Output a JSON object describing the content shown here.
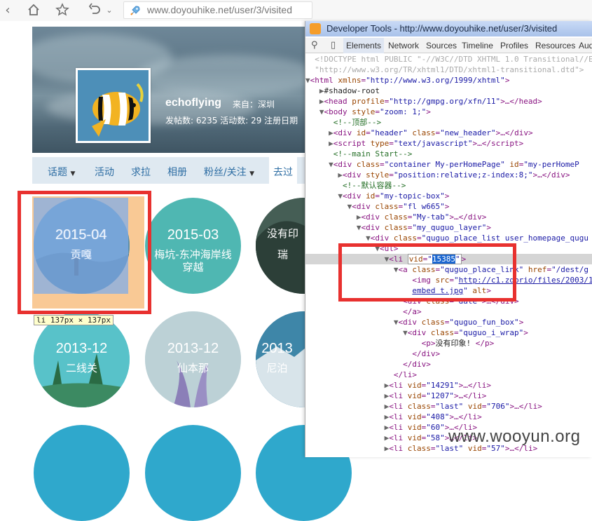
{
  "browser": {
    "url": "www.doyouhike.net/user/3/visited"
  },
  "profile": {
    "username": "echoflying",
    "location": "来自：深圳",
    "stats": "发帖数: 6235    活动数: 29    注册日期"
  },
  "nav": {
    "items": [
      "话题",
      "活动",
      "求拉",
      "相册",
      "粉丝/关注",
      "去过"
    ]
  },
  "tiles": [
    {
      "date": "2015-04",
      "name": "贡嘎"
    },
    {
      "date": "2015-03",
      "name": "梅坑-东冲海岸线",
      "name2": "穿越"
    },
    {
      "date": "",
      "name": "没有印",
      "name2": "瑞"
    },
    {
      "date": "2013-12",
      "name": "二线关"
    },
    {
      "date": "2013-12",
      "name": "仙本那"
    },
    {
      "date": "2013",
      "name": "尼泊"
    }
  ],
  "tooltip": {
    "text": "li 137px × 137px"
  },
  "devtools": {
    "title": "Developer Tools - http://www.doyouhike.net/user/3/visited",
    "tabs": [
      "Elements",
      "Network",
      "Sources",
      "Timeline",
      "Profiles",
      "Resources",
      "Aud"
    ],
    "selected_vid": "15385"
  },
  "watermark": "www.wooyun.org",
  "colors": {
    "highlight_red": "#e8312f",
    "link_blue": "#2d6da3",
    "teal": "#4fb7b2"
  }
}
